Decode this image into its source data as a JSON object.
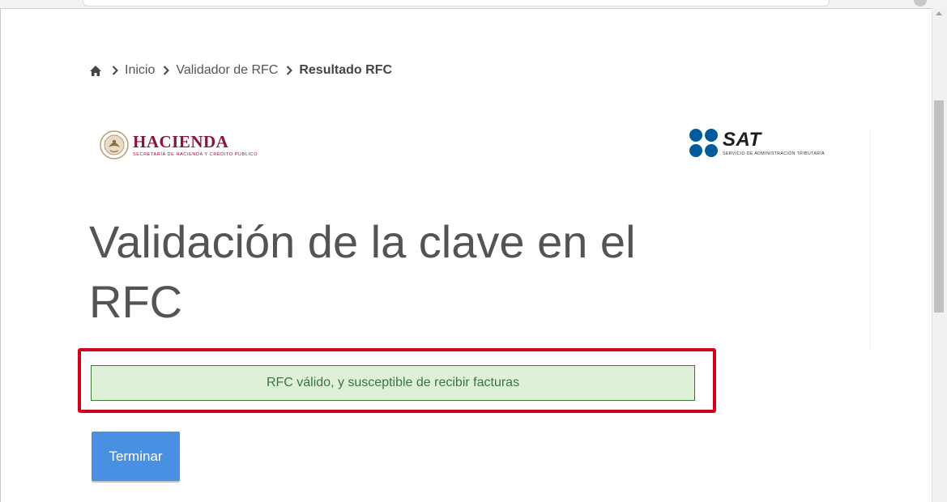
{
  "breadcrumb": {
    "items": [
      {
        "label": "Inicio"
      },
      {
        "label": "Validador de RFC"
      },
      {
        "label": "Resultado RFC"
      }
    ]
  },
  "logos": {
    "hacienda": {
      "name": "HACIENDA",
      "subtitle": "SECRETARÍA DE HACIENDA Y CRÉDITO PÚBLICO",
      "color": "#8a1538"
    },
    "sat": {
      "name": "SAT",
      "subtitle": "SERVICIO DE ADMINISTRACIÓN TRIBUTARIA",
      "color": "#005a9c"
    }
  },
  "main": {
    "title": "Validación de la clave en el RFC",
    "result_message": "RFC válido, y susceptible de recibir facturas",
    "finish_button": "Terminar"
  },
  "colors": {
    "highlight_border": "#d0021b",
    "success_bg": "#dff0d8",
    "success_text": "#3c763d",
    "button_bg": "#4a90e2"
  },
  "icons": {
    "home": "home-icon",
    "separator": "chevron-right-icon"
  }
}
